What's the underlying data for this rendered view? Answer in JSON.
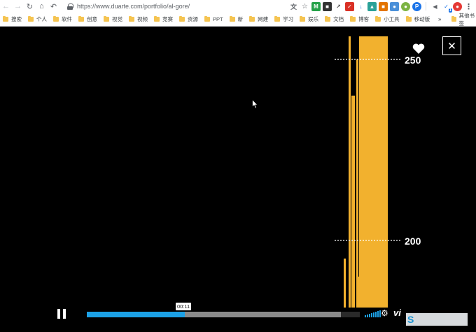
{
  "browser": {
    "url": "https://www.duarte.com/portfolio/al-gore/",
    "bookmarks": [
      "搜索",
      "个人",
      "软件",
      "创意",
      "视觉",
      "视频",
      "竞赛",
      "资源",
      "PPT",
      "新",
      "网建",
      "学习",
      "娱乐",
      "文档",
      "博客",
      "小工具",
      "移动版"
    ],
    "more": "»",
    "other_bookmarks": "其他书签",
    "badge_count": "1"
  },
  "video": {
    "current_time": "00:11",
    "progress": 0.36,
    "loaded": 0.93,
    "vimeo_label": "vi",
    "watermark_label": "S"
  },
  "chart_data": {
    "type": "bar",
    "y_tick_labels": [
      "250",
      "200"
    ],
    "ylim": [
      180,
      260
    ],
    "bar_color": "#f2b12e",
    "values": [
      175,
      195,
      260,
      240,
      250,
      190,
      228,
      270
    ],
    "grid": "dotted reference lines at labeled ticks"
  },
  "colors": {
    "accent": "#1ca1e6",
    "bar": "#f2b12e",
    "background": "#000000"
  }
}
